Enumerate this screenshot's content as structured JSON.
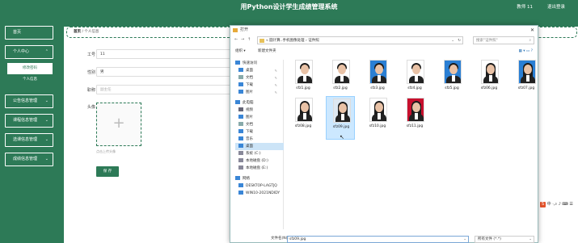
{
  "header": {
    "title": "用Python设计学生成绩管理系统",
    "user": "教师 11",
    "logout": "退出登录"
  },
  "sidebar": {
    "home": "首页",
    "personal_center": "个人中心",
    "personal_sub": [
      "修改密码",
      "个人信息"
    ],
    "items": [
      "公告信息管理",
      "课程信息管理",
      "选课信息管理",
      "成绩信息管理"
    ]
  },
  "breadcrumb": {
    "home": "首页",
    "separator": "/",
    "current": "个人信息"
  },
  "form": {
    "id_label": "工号",
    "id_value": "11",
    "gender_label": "性别",
    "gender_value": "男",
    "title_label": "职称",
    "title_placeholder": "副主任",
    "avatar_label": "头像",
    "avatar_hint": "点击上传头像",
    "save": "保 存"
  },
  "dialog": {
    "title": "打开",
    "address": "« 圆计算..手机图像处理 › 证件照",
    "search_placeholder": "搜索\"证件照\"",
    "organize": "组织 ▾",
    "new_folder": "新建文件夹",
    "tree": [
      {
        "label": "快速访问",
        "icon": "star-icon",
        "color": "#3a86d6"
      },
      {
        "label": "桌面",
        "icon": "desktop-icon",
        "color": "#3a86d6",
        "pinned": true
      },
      {
        "label": "文档",
        "icon": "document-icon",
        "color": "#8aa",
        "pinned": true
      },
      {
        "label": "下载",
        "icon": "download-icon",
        "color": "#3a86d6",
        "pinned": true
      },
      {
        "label": "图片",
        "icon": "picture-icon",
        "color": "#3a86d6",
        "pinned": true
      },
      {
        "label": "此电脑",
        "icon": "computer-icon",
        "color": "#3a86d6"
      },
      {
        "label": "视频",
        "icon": "video-icon",
        "color": "#667"
      },
      {
        "label": "图片",
        "icon": "picture-icon",
        "color": "#3a86d6"
      },
      {
        "label": "文档",
        "icon": "document-icon",
        "color": "#8aa"
      },
      {
        "label": "下载",
        "icon": "download-icon",
        "color": "#3a86d6"
      },
      {
        "label": "音乐",
        "icon": "music-icon",
        "color": "#3a86d6"
      },
      {
        "label": "桌面",
        "icon": "desktop-icon",
        "color": "#3a86d6",
        "selected": true
      },
      {
        "label": "系统 (C:)",
        "icon": "drive-icon",
        "color": "#889"
      },
      {
        "label": "本地磁盘 (D:)",
        "icon": "drive-icon",
        "color": "#889"
      },
      {
        "label": "本地磁盘 (E:)",
        "icon": "drive-icon",
        "color": "#889"
      },
      {
        "label": "网络",
        "icon": "network-icon",
        "color": "#3a86d6"
      },
      {
        "label": "DESKTOP-LAGTJQ",
        "icon": "computer-icon",
        "color": "#3a86d6"
      },
      {
        "label": "WIN10-2021NDIDY",
        "icon": "computer-icon",
        "color": "#3a86d6"
      }
    ],
    "files": [
      {
        "name": "sfz1.jpg",
        "bg": "#ffffff",
        "hair": "short"
      },
      {
        "name": "sfz2.jpg",
        "bg": "#ffffff",
        "hair": "short"
      },
      {
        "name": "sfz3.jpg",
        "bg": "#2a7fd4",
        "hair": "short"
      },
      {
        "name": "sfz4.jpg",
        "bg": "#ffffff",
        "hair": "short"
      },
      {
        "name": "sfz5.jpg",
        "bg": "#2a7fd4",
        "hair": "short"
      },
      {
        "name": "sfz06.jpg",
        "bg": "#ffffff",
        "hair": "long"
      },
      {
        "name": "sfz07.jpg",
        "bg": "#2a7fd4",
        "hair": "long"
      },
      {
        "name": "sfz08.jpg",
        "bg": "#ffffff",
        "hair": "long"
      },
      {
        "name": "sfz09.jpg",
        "bg": "#dde8f2",
        "hair": "long",
        "selected": true
      },
      {
        "name": "sfz10.jpg",
        "bg": "#ffffff",
        "hair": "long"
      },
      {
        "name": "sfz11.jpg",
        "bg": "#c8102e",
        "hair": "long"
      }
    ],
    "filename_label": "文件名(N):",
    "filename_value": "sfz09.jpg",
    "filetype_value": "所有文件 (*.*)"
  },
  "ime": {
    "logo": "S",
    "mode": "中"
  }
}
